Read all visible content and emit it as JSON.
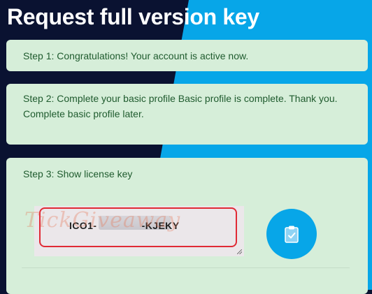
{
  "page": {
    "title": "Request full version key"
  },
  "steps": [
    {
      "text": "Step 1: Congratulations! Your account is active now."
    },
    {
      "text": "Step 2: Complete your basic profile Basic profile is complete. Thank you. Complete basic profile later."
    },
    {
      "text": "Step 3: Show license key"
    }
  ],
  "license": {
    "value": "ICO1-               -KJEKY",
    "watermark": "TickGiveaway"
  },
  "copy_button": {
    "icon": "clipboard-check-icon"
  },
  "colors": {
    "card_bg": "#d6eed9",
    "card_text": "#1f5b2e",
    "accent": "#07a6e8",
    "dark_bg": "#0a1231",
    "highlight": "#e02a35"
  }
}
